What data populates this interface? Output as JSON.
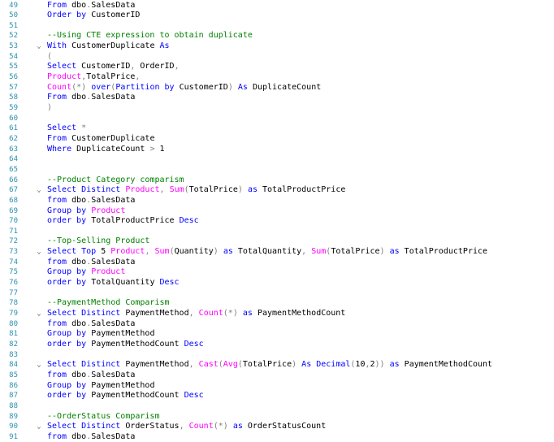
{
  "colors": {
    "background": "#ffffff",
    "line_number": "#2b91af",
    "keyword": "#0000ff",
    "function": "#ff00ff",
    "comment": "#008000",
    "operator": "#808080",
    "text": "#000000"
  },
  "icons": {
    "fold": "chevron-down-icon"
  },
  "lines": [
    {
      "n": "49",
      "fold": false,
      "tokens": [
        {
          "t": "kw",
          "v": "From"
        },
        {
          "t": "tx",
          "v": " dbo"
        },
        {
          "t": "op",
          "v": "."
        },
        {
          "t": "tx",
          "v": "SalesData"
        }
      ]
    },
    {
      "n": "50",
      "fold": false,
      "tokens": [
        {
          "t": "kw",
          "v": "Order by"
        },
        {
          "t": "tx",
          "v": " CustomerID"
        }
      ]
    },
    {
      "n": "51",
      "fold": false,
      "tokens": []
    },
    {
      "n": "52",
      "fold": false,
      "tokens": [
        {
          "t": "cm",
          "v": "--Using CTE expression to obtain duplicate"
        }
      ]
    },
    {
      "n": "53",
      "fold": true,
      "tokens": [
        {
          "t": "kw",
          "v": "With"
        },
        {
          "t": "tx",
          "v": " CustomerDuplicate "
        },
        {
          "t": "kw",
          "v": "As"
        }
      ]
    },
    {
      "n": "54",
      "fold": false,
      "tokens": [
        {
          "t": "op",
          "v": "("
        }
      ]
    },
    {
      "n": "55",
      "fold": false,
      "tokens": [
        {
          "t": "kw",
          "v": "Select"
        },
        {
          "t": "tx",
          "v": " CustomerID"
        },
        {
          "t": "op",
          "v": ","
        },
        {
          "t": "tx",
          "v": " OrderID"
        },
        {
          "t": "op",
          "v": ","
        }
      ]
    },
    {
      "n": "56",
      "fold": false,
      "tokens": [
        {
          "t": "fn",
          "v": "Product"
        },
        {
          "t": "op",
          "v": ","
        },
        {
          "t": "tx",
          "v": "TotalPrice"
        },
        {
          "t": "op",
          "v": ","
        }
      ]
    },
    {
      "n": "57",
      "fold": false,
      "tokens": [
        {
          "t": "fn",
          "v": "Count"
        },
        {
          "t": "op",
          "v": "(*)"
        },
        {
          "t": "tx",
          "v": " "
        },
        {
          "t": "kw",
          "v": "over"
        },
        {
          "t": "op",
          "v": "("
        },
        {
          "t": "kw",
          "v": "Partition by"
        },
        {
          "t": "tx",
          "v": " CustomerID"
        },
        {
          "t": "op",
          "v": ")"
        },
        {
          "t": "tx",
          "v": " "
        },
        {
          "t": "kw",
          "v": "As"
        },
        {
          "t": "tx",
          "v": " DuplicateCount"
        }
      ]
    },
    {
      "n": "58",
      "fold": false,
      "tokens": [
        {
          "t": "kw",
          "v": "From"
        },
        {
          "t": "tx",
          "v": " dbo"
        },
        {
          "t": "op",
          "v": "."
        },
        {
          "t": "tx",
          "v": "SalesData"
        }
      ]
    },
    {
      "n": "59",
      "fold": false,
      "tokens": [
        {
          "t": "op",
          "v": ")"
        }
      ]
    },
    {
      "n": "60",
      "fold": false,
      "tokens": []
    },
    {
      "n": "61",
      "fold": false,
      "tokens": [
        {
          "t": "kw",
          "v": "Select"
        },
        {
          "t": "tx",
          "v": " "
        },
        {
          "t": "op",
          "v": "*"
        }
      ]
    },
    {
      "n": "62",
      "fold": false,
      "tokens": [
        {
          "t": "kw",
          "v": "From"
        },
        {
          "t": "tx",
          "v": " CustomerDuplicate"
        }
      ]
    },
    {
      "n": "63",
      "fold": false,
      "tokens": [
        {
          "t": "kw",
          "v": "Where"
        },
        {
          "t": "tx",
          "v": " DuplicateCount "
        },
        {
          "t": "op",
          "v": ">"
        },
        {
          "t": "tx",
          "v": " 1"
        }
      ]
    },
    {
      "n": "64",
      "fold": false,
      "tokens": []
    },
    {
      "n": "65",
      "fold": false,
      "tokens": []
    },
    {
      "n": "66",
      "fold": false,
      "tokens": [
        {
          "t": "cm",
          "v": "--Product Category comparism"
        }
      ]
    },
    {
      "n": "67",
      "fold": true,
      "tokens": [
        {
          "t": "kw",
          "v": "Select Distinct"
        },
        {
          "t": "tx",
          "v": " "
        },
        {
          "t": "fn",
          "v": "Product"
        },
        {
          "t": "op",
          "v": ","
        },
        {
          "t": "tx",
          "v": " "
        },
        {
          "t": "fn",
          "v": "Sum"
        },
        {
          "t": "op",
          "v": "("
        },
        {
          "t": "tx",
          "v": "TotalPrice"
        },
        {
          "t": "op",
          "v": ")"
        },
        {
          "t": "tx",
          "v": " "
        },
        {
          "t": "kw",
          "v": "as"
        },
        {
          "t": "tx",
          "v": " TotalProductPrice"
        }
      ]
    },
    {
      "n": "68",
      "fold": false,
      "tokens": [
        {
          "t": "kw",
          "v": "from"
        },
        {
          "t": "tx",
          "v": " dbo"
        },
        {
          "t": "op",
          "v": "."
        },
        {
          "t": "tx",
          "v": "SalesData"
        }
      ]
    },
    {
      "n": "69",
      "fold": false,
      "tokens": [
        {
          "t": "kw",
          "v": "Group by"
        },
        {
          "t": "tx",
          "v": " "
        },
        {
          "t": "fn",
          "v": "Product"
        }
      ]
    },
    {
      "n": "70",
      "fold": false,
      "tokens": [
        {
          "t": "kw",
          "v": "order by"
        },
        {
          "t": "tx",
          "v": " TotalProductPrice "
        },
        {
          "t": "kw",
          "v": "Desc"
        }
      ]
    },
    {
      "n": "71",
      "fold": false,
      "tokens": []
    },
    {
      "n": "72",
      "fold": false,
      "tokens": [
        {
          "t": "cm",
          "v": "--Top-Selling Product"
        }
      ]
    },
    {
      "n": "73",
      "fold": true,
      "tokens": [
        {
          "t": "kw",
          "v": "Select Top"
        },
        {
          "t": "tx",
          "v": " 5 "
        },
        {
          "t": "fn",
          "v": "Product"
        },
        {
          "t": "op",
          "v": ","
        },
        {
          "t": "tx",
          "v": " "
        },
        {
          "t": "fn",
          "v": "Sum"
        },
        {
          "t": "op",
          "v": "("
        },
        {
          "t": "tx",
          "v": "Quantity"
        },
        {
          "t": "op",
          "v": ")"
        },
        {
          "t": "tx",
          "v": " "
        },
        {
          "t": "kw",
          "v": "as"
        },
        {
          "t": "tx",
          "v": " TotalQuantity"
        },
        {
          "t": "op",
          "v": ","
        },
        {
          "t": "tx",
          "v": " "
        },
        {
          "t": "fn",
          "v": "Sum"
        },
        {
          "t": "op",
          "v": "("
        },
        {
          "t": "tx",
          "v": "TotalPrice"
        },
        {
          "t": "op",
          "v": ")"
        },
        {
          "t": "tx",
          "v": " "
        },
        {
          "t": "kw",
          "v": "as"
        },
        {
          "t": "tx",
          "v": " TotalProductPrice"
        }
      ]
    },
    {
      "n": "74",
      "fold": false,
      "tokens": [
        {
          "t": "kw",
          "v": "from"
        },
        {
          "t": "tx",
          "v": " dbo"
        },
        {
          "t": "op",
          "v": "."
        },
        {
          "t": "tx",
          "v": "SalesData"
        }
      ]
    },
    {
      "n": "75",
      "fold": false,
      "tokens": [
        {
          "t": "kw",
          "v": "Group by"
        },
        {
          "t": "tx",
          "v": " "
        },
        {
          "t": "fn",
          "v": "Product"
        }
      ]
    },
    {
      "n": "76",
      "fold": false,
      "tokens": [
        {
          "t": "kw",
          "v": "order by"
        },
        {
          "t": "tx",
          "v": " TotalQuantity "
        },
        {
          "t": "kw",
          "v": "Desc"
        }
      ]
    },
    {
      "n": "77",
      "fold": false,
      "tokens": []
    },
    {
      "n": "78",
      "fold": false,
      "tokens": [
        {
          "t": "cm",
          "v": "--PaymentMethod Comparism"
        }
      ]
    },
    {
      "n": "79",
      "fold": true,
      "tokens": [
        {
          "t": "kw",
          "v": "Select Distinct"
        },
        {
          "t": "tx",
          "v": " PaymentMethod"
        },
        {
          "t": "op",
          "v": ","
        },
        {
          "t": "tx",
          "v": " "
        },
        {
          "t": "fn",
          "v": "Count"
        },
        {
          "t": "op",
          "v": "(*)"
        },
        {
          "t": "tx",
          "v": " "
        },
        {
          "t": "kw",
          "v": "as"
        },
        {
          "t": "tx",
          "v": " PaymentMethodCount"
        }
      ]
    },
    {
      "n": "80",
      "fold": false,
      "tokens": [
        {
          "t": "kw",
          "v": "from"
        },
        {
          "t": "tx",
          "v": " dbo"
        },
        {
          "t": "op",
          "v": "."
        },
        {
          "t": "tx",
          "v": "SalesData"
        }
      ]
    },
    {
      "n": "81",
      "fold": false,
      "tokens": [
        {
          "t": "kw",
          "v": "Group by"
        },
        {
          "t": "tx",
          "v": " PaymentMethod"
        }
      ]
    },
    {
      "n": "82",
      "fold": false,
      "tokens": [
        {
          "t": "kw",
          "v": "order by"
        },
        {
          "t": "tx",
          "v": " PaymentMethodCount "
        },
        {
          "t": "kw",
          "v": "Desc"
        }
      ]
    },
    {
      "n": "83",
      "fold": false,
      "tokens": []
    },
    {
      "n": "84",
      "fold": true,
      "tokens": [
        {
          "t": "kw",
          "v": "Select Distinct"
        },
        {
          "t": "tx",
          "v": " PaymentMethod"
        },
        {
          "t": "op",
          "v": ","
        },
        {
          "t": "tx",
          "v": " "
        },
        {
          "t": "fn",
          "v": "Cast"
        },
        {
          "t": "op",
          "v": "("
        },
        {
          "t": "fn",
          "v": "Avg"
        },
        {
          "t": "op",
          "v": "("
        },
        {
          "t": "tx",
          "v": "TotalPrice"
        },
        {
          "t": "op",
          "v": ")"
        },
        {
          "t": "tx",
          "v": " "
        },
        {
          "t": "kw",
          "v": "As Decimal"
        },
        {
          "t": "op",
          "v": "("
        },
        {
          "t": "tx",
          "v": "10"
        },
        {
          "t": "op",
          "v": ","
        },
        {
          "t": "tx",
          "v": "2"
        },
        {
          "t": "op",
          "v": "))"
        },
        {
          "t": "tx",
          "v": " "
        },
        {
          "t": "kw",
          "v": "as"
        },
        {
          "t": "tx",
          "v": " PaymentMethodCount"
        }
      ]
    },
    {
      "n": "85",
      "fold": false,
      "tokens": [
        {
          "t": "kw",
          "v": "from"
        },
        {
          "t": "tx",
          "v": " dbo"
        },
        {
          "t": "op",
          "v": "."
        },
        {
          "t": "tx",
          "v": "SalesData"
        }
      ]
    },
    {
      "n": "86",
      "fold": false,
      "tokens": [
        {
          "t": "kw",
          "v": "Group by"
        },
        {
          "t": "tx",
          "v": " PaymentMethod"
        }
      ]
    },
    {
      "n": "87",
      "fold": false,
      "tokens": [
        {
          "t": "kw",
          "v": "order by"
        },
        {
          "t": "tx",
          "v": " PaymentMethodCount "
        },
        {
          "t": "kw",
          "v": "Desc"
        }
      ]
    },
    {
      "n": "88",
      "fold": false,
      "tokens": []
    },
    {
      "n": "89",
      "fold": false,
      "tokens": [
        {
          "t": "cm",
          "v": "--OrderStatus Comparism"
        }
      ]
    },
    {
      "n": "90",
      "fold": true,
      "tokens": [
        {
          "t": "kw",
          "v": "Select Distinct"
        },
        {
          "t": "tx",
          "v": " OrderStatus"
        },
        {
          "t": "op",
          "v": ","
        },
        {
          "t": "tx",
          "v": " "
        },
        {
          "t": "fn",
          "v": "Count"
        },
        {
          "t": "op",
          "v": "(*)"
        },
        {
          "t": "tx",
          "v": " "
        },
        {
          "t": "kw",
          "v": "as"
        },
        {
          "t": "tx",
          "v": " OrderStatusCount"
        }
      ]
    },
    {
      "n": "91",
      "fold": false,
      "tokens": [
        {
          "t": "kw",
          "v": "from"
        },
        {
          "t": "tx",
          "v": " dbo"
        },
        {
          "t": "op",
          "v": "."
        },
        {
          "t": "tx",
          "v": "SalesData"
        }
      ]
    }
  ]
}
